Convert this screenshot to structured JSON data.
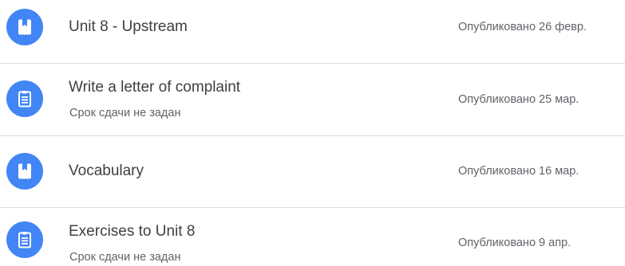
{
  "posts": [
    {
      "icon": "material-icon",
      "title": "Unit 8 - Upstream",
      "subtitle": "",
      "date": "Опубликовано 26 февр."
    },
    {
      "icon": "assignment-icon",
      "title": "Write a letter of complaint",
      "subtitle": "Срок сдачи не задан",
      "date": "Опубликовано 25 мар."
    },
    {
      "icon": "material-icon",
      "title": "Vocabulary",
      "subtitle": "",
      "date": "Опубликовано 16 мар."
    },
    {
      "icon": "assignment-icon",
      "title": "Exercises to Unit 8",
      "subtitle": "Срок сдачи не задан",
      "date": "Опубликовано 9 апр."
    }
  ],
  "colors": {
    "icon_background": "#4285f4",
    "title_text": "#3c4043",
    "secondary_text": "#5f6368",
    "divider": "#dadce0"
  }
}
